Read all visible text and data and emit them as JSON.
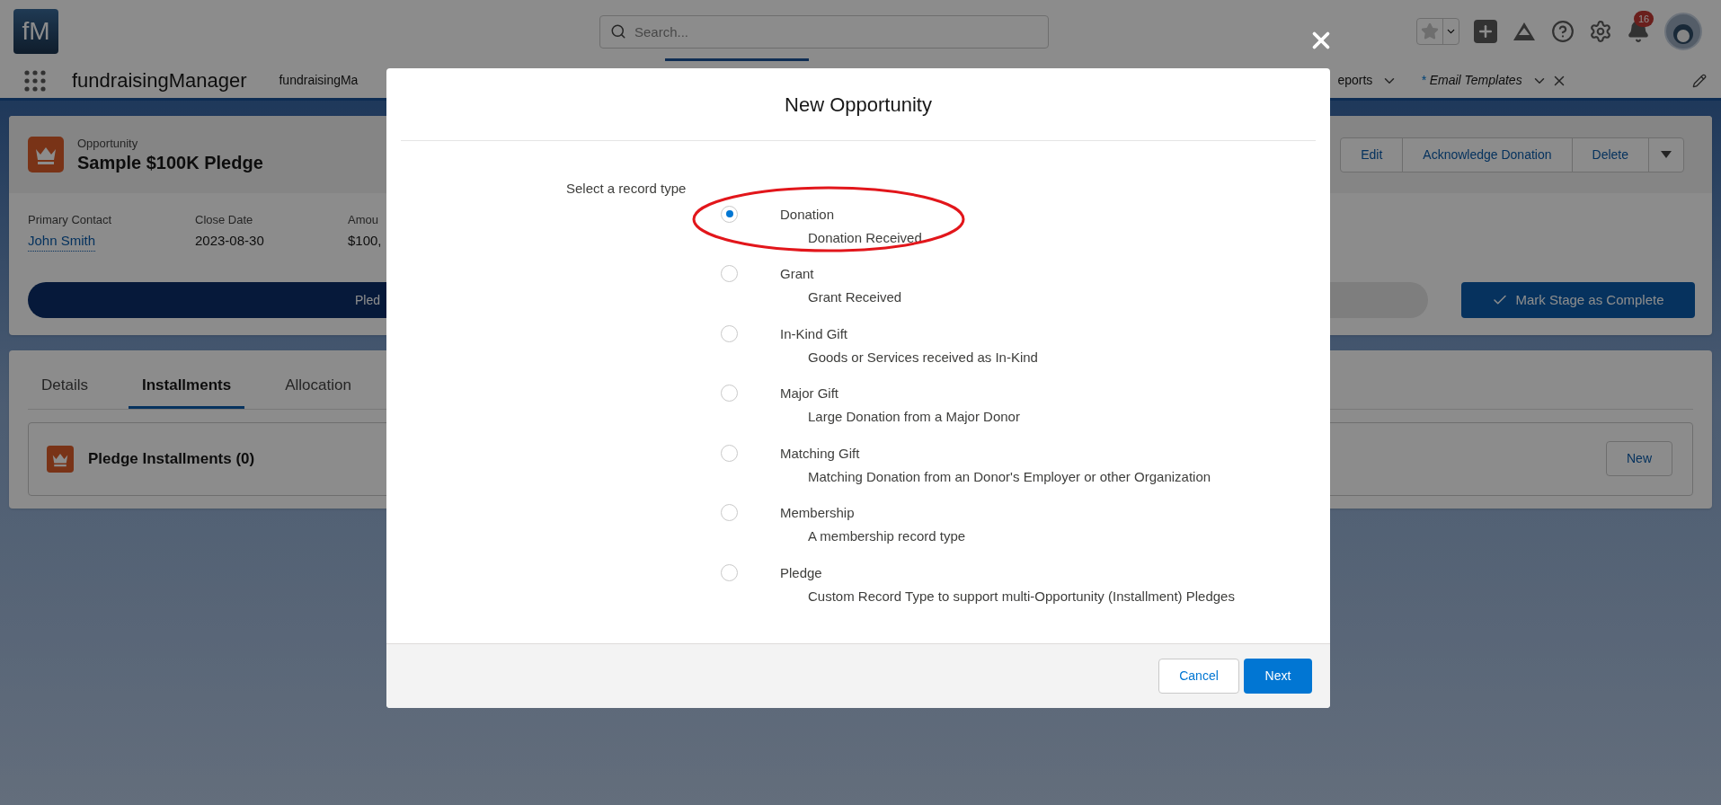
{
  "header": {
    "logo": "fM",
    "search": {
      "placeholder": "Search..."
    },
    "notification_count": "16"
  },
  "nav": {
    "app_name": "fundraisingManager",
    "tabs": [
      {
        "label": "fundraisingMa",
        "kind": "plain"
      },
      {
        "label": "eports",
        "kind": "menu"
      },
      {
        "label": "Email Templates",
        "marker": "*",
        "kind": "unsaved"
      }
    ]
  },
  "record": {
    "object_type": "Opportunity",
    "name": "Sample $100K Pledge",
    "actions": [
      "Edit",
      "Acknowledge Donation",
      "Delete"
    ],
    "fields": [
      {
        "label": "Primary Contact",
        "value": "John Smith",
        "kind": "link"
      },
      {
        "label": "Close Date",
        "value": "2023-08-30",
        "kind": "text"
      },
      {
        "label": "Amou",
        "value": "$100,",
        "kind": "text"
      }
    ],
    "path_stage": "Pled",
    "complete_button": "Mark Stage as Complete"
  },
  "tabs": [
    {
      "label": "Details",
      "selected": false
    },
    {
      "label": "Installments",
      "selected": true
    },
    {
      "label": "Allocation",
      "selected": false
    }
  ],
  "related_list": {
    "title": "Pledge Installments (0)",
    "button": "New"
  },
  "modal": {
    "title": "New Opportunity",
    "prompt": "Select a record type",
    "options": [
      {
        "name": "Donation",
        "description": "Donation Received",
        "selected": true,
        "highlighted": true
      },
      {
        "name": "Grant",
        "description": "Grant Received",
        "selected": false,
        "highlighted": false
      },
      {
        "name": "In-Kind Gift",
        "description": "Goods or Services received as In-Kind",
        "selected": false,
        "highlighted": false
      },
      {
        "name": "Major Gift",
        "description": "Large Donation from a Major Donor",
        "selected": false,
        "highlighted": false
      },
      {
        "name": "Matching Gift",
        "description": "Matching Donation from an Donor's Employer or other Organization",
        "selected": false,
        "highlighted": false
      },
      {
        "name": "Membership",
        "description": "A membership record type",
        "selected": false,
        "highlighted": false
      },
      {
        "name": "Pledge",
        "description": "Custom Record Type to support multi-Opportunity (Installment) Pledges",
        "selected": false,
        "highlighted": false
      }
    ],
    "buttons": [
      {
        "label": "Cancel",
        "kind": "neutral"
      },
      {
        "label": "Next",
        "kind": "brand"
      }
    ]
  }
}
